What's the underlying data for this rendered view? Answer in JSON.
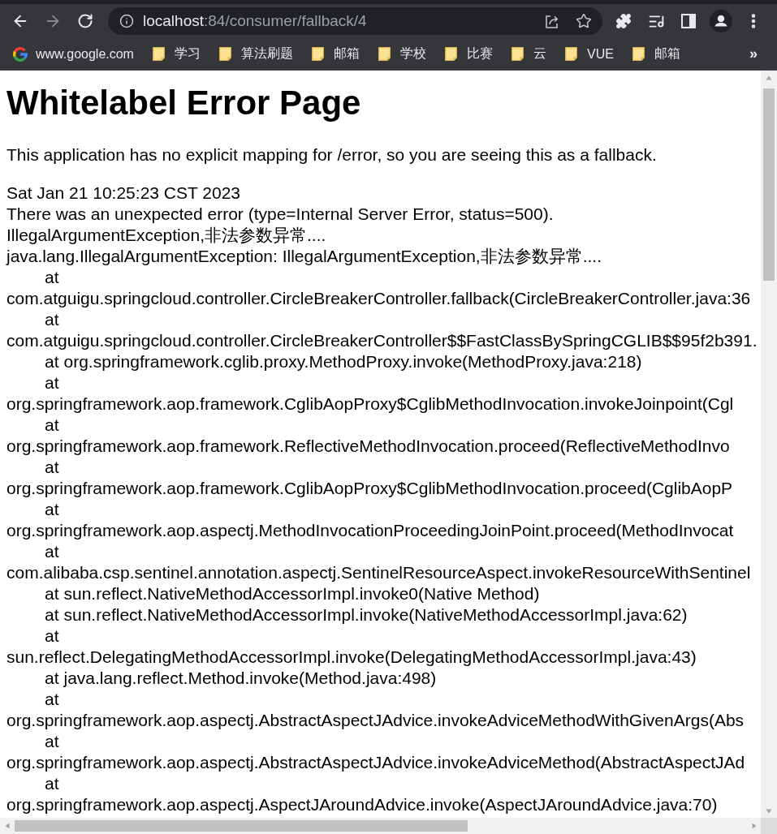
{
  "toolbar": {
    "forward": {
      "disabled": true
    }
  },
  "address_bar": {
    "host": "localhost",
    "path": ":84/consumer/fallback/4"
  },
  "bookmarks": {
    "items": [
      {
        "kind": "site",
        "label": "www.google.com"
      },
      {
        "kind": "folder",
        "label": "学习"
      },
      {
        "kind": "folder",
        "label": "算法刷题"
      },
      {
        "kind": "folder",
        "label": "邮箱"
      },
      {
        "kind": "folder",
        "label": "学校"
      },
      {
        "kind": "folder",
        "label": "比赛"
      },
      {
        "kind": "folder",
        "label": "云"
      },
      {
        "kind": "folder",
        "label": "VUE"
      },
      {
        "kind": "folder",
        "label": "邮箱"
      }
    ],
    "overflow": "»"
  },
  "page": {
    "title": "Whitelabel Error Page",
    "intro": "This application has no explicit mapping for /error, so you are seeing this as a fallback.",
    "timestamp": "Sat Jan 21 10:25:23 CST 2023",
    "error": "There was an unexpected error (type=Internal Server Error, status=500).",
    "message": "IllegalArgumentException,非法参数异常....",
    "exception": "java.lang.IllegalArgumentException: IllegalArgumentException,非法参数异常....",
    "frames": [
      {
        "at": "at",
        "call": "com.atguigu.springcloud.controller.CircleBreakerController.fallback(CircleBreakerController.java:36",
        "wrapped": true
      },
      {
        "at": "at",
        "call": "com.atguigu.springcloud.controller.CircleBreakerController$$FastClassBySpringCGLIB$$95f2b391.",
        "wrapped": true
      },
      {
        "at": "at",
        "call": "org.springframework.cglib.proxy.MethodProxy.invoke(MethodProxy.java:218)",
        "wrapped": false
      },
      {
        "at": "at",
        "call": "org.springframework.aop.framework.CglibAopProxy$CglibMethodInvocation.invokeJoinpoint(Cgl",
        "wrapped": true
      },
      {
        "at": "at",
        "call": "org.springframework.aop.framework.ReflectiveMethodInvocation.proceed(ReflectiveMethodInvo",
        "wrapped": true
      },
      {
        "at": "at",
        "call": "org.springframework.aop.framework.CglibAopProxy$CglibMethodInvocation.proceed(CglibAopP",
        "wrapped": true
      },
      {
        "at": "at",
        "call": "org.springframework.aop.aspectj.MethodInvocationProceedingJoinPoint.proceed(MethodInvocat",
        "wrapped": true
      },
      {
        "at": "at",
        "call": "com.alibaba.csp.sentinel.annotation.aspectj.SentinelResourceAspect.invokeResourceWithSentinel",
        "wrapped": true
      },
      {
        "at": "at",
        "call": "sun.reflect.NativeMethodAccessorImpl.invoke0(Native Method)",
        "wrapped": false
      },
      {
        "at": "at",
        "call": "sun.reflect.NativeMethodAccessorImpl.invoke(NativeMethodAccessorImpl.java:62)",
        "wrapped": false
      },
      {
        "at": "at",
        "call": "sun.reflect.DelegatingMethodAccessorImpl.invoke(DelegatingMethodAccessorImpl.java:43)",
        "wrapped": true
      },
      {
        "at": "at",
        "call": "java.lang.reflect.Method.invoke(Method.java:498)",
        "wrapped": false
      },
      {
        "at": "at",
        "call": "org.springframework.aop.aspectj.AbstractAspectJAdvice.invokeAdviceMethodWithGivenArgs(Abs",
        "wrapped": true
      },
      {
        "at": "at",
        "call": "org.springframework.aop.aspectj.AbstractAspectJAdvice.invokeAdviceMethod(AbstractAspectJAd",
        "wrapped": true
      },
      {
        "at": "at",
        "call": "org.springframework.aop.aspectj.AspectJAroundAdvice.invoke(AspectJAroundAdvice.java:70)",
        "wrapped": true
      }
    ]
  }
}
